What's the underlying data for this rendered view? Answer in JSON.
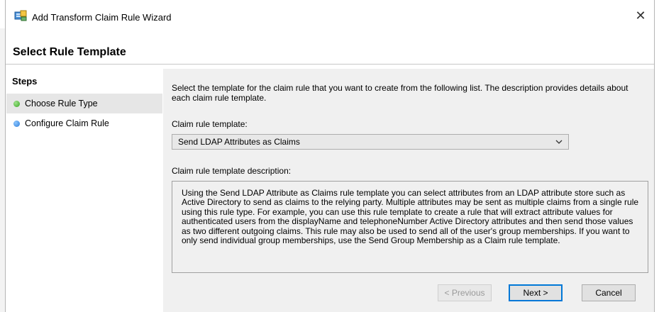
{
  "window": {
    "title": "Add Transform Claim Rule Wizard",
    "close_glyph": "✕"
  },
  "header": {
    "title": "Select Rule Template"
  },
  "sidebar": {
    "heading": "Steps",
    "items": [
      {
        "label": "Choose Rule Type",
        "status_color": "#3aa624",
        "active": true
      },
      {
        "label": "Configure Claim Rule",
        "status_color": "#2f7ed8",
        "active": false
      }
    ]
  },
  "main": {
    "intro": "Select the template for the claim rule that you want to create from the following list. The description provides details about each claim rule template.",
    "template_label": "Claim rule template:",
    "template_selected": "Send LDAP Attributes as Claims",
    "description_label": "Claim rule template description:",
    "description": "Using the Send LDAP Attribute as Claims rule template you can select attributes from an LDAP attribute store such as Active Directory to send as claims to the relying party. Multiple attributes may be sent as multiple claims from a single rule using this rule type. For example, you can use this rule template to create a rule that will extract attribute values for authenticated users from the displayName and telephoneNumber Active Directory attributes and then send those values as two different outgoing claims. This rule may also be used to send all of the user's group memberships. If you want to only send individual group memberships, use the Send Group Membership as a Claim rule template."
  },
  "buttons": {
    "previous": "< Previous",
    "next": "Next >",
    "cancel": "Cancel"
  },
  "colors": {
    "accent": "#0078d7",
    "content_bg": "#f0f0f0",
    "active_step_bg": "#e6e6e6"
  },
  "icons": {
    "app": "server-network-icon",
    "close": "close-icon",
    "dropdown": "chevron-down-icon"
  }
}
